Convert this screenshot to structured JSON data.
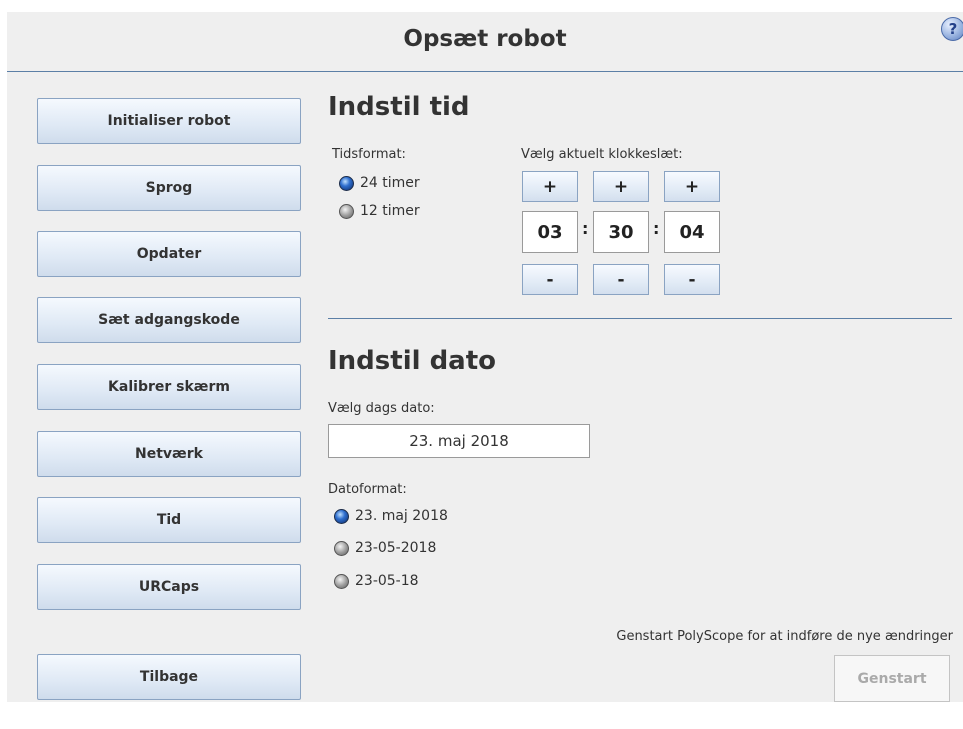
{
  "header": {
    "title": "Opsæt robot",
    "help_label": "?"
  },
  "sidebar": {
    "items": [
      {
        "label": "Initialiser robot"
      },
      {
        "label": "Sprog"
      },
      {
        "label": "Opdater"
      },
      {
        "label": "Sæt adgangskode"
      },
      {
        "label": "Kalibrer skærm"
      },
      {
        "label": "Netværk"
      },
      {
        "label": "Tid"
      },
      {
        "label": "URCaps"
      }
    ],
    "back_label": "Tilbage"
  },
  "time_section": {
    "title": "Indstil tid",
    "format_label": "Tidsformat:",
    "format_options": [
      {
        "label": "24 timer",
        "selected": true
      },
      {
        "label": "12 timer",
        "selected": false
      }
    ],
    "clock_label": "Vælg aktuelt klokkeslæt:",
    "increment_label": "+",
    "decrement_label": "-",
    "separator": ":",
    "hours": "03",
    "minutes": "30",
    "seconds": "04"
  },
  "date_section": {
    "title": "Indstil dato",
    "select_label": "Vælg dags dato:",
    "current_date": "23. maj 2018",
    "format_label": "Datoformat:",
    "format_options": [
      {
        "label": "23. maj 2018",
        "selected": true
      },
      {
        "label": "23-05-2018",
        "selected": false
      },
      {
        "label": "23-05-18",
        "selected": false
      }
    ]
  },
  "footer": {
    "restart_message": "Genstart PolyScope for at indføre de nye ændringer",
    "restart_label": "Genstart"
  },
  "colors": {
    "accent_line": "#5c7fa6",
    "button_border": "#8aa3c2",
    "background": "#efefef"
  }
}
